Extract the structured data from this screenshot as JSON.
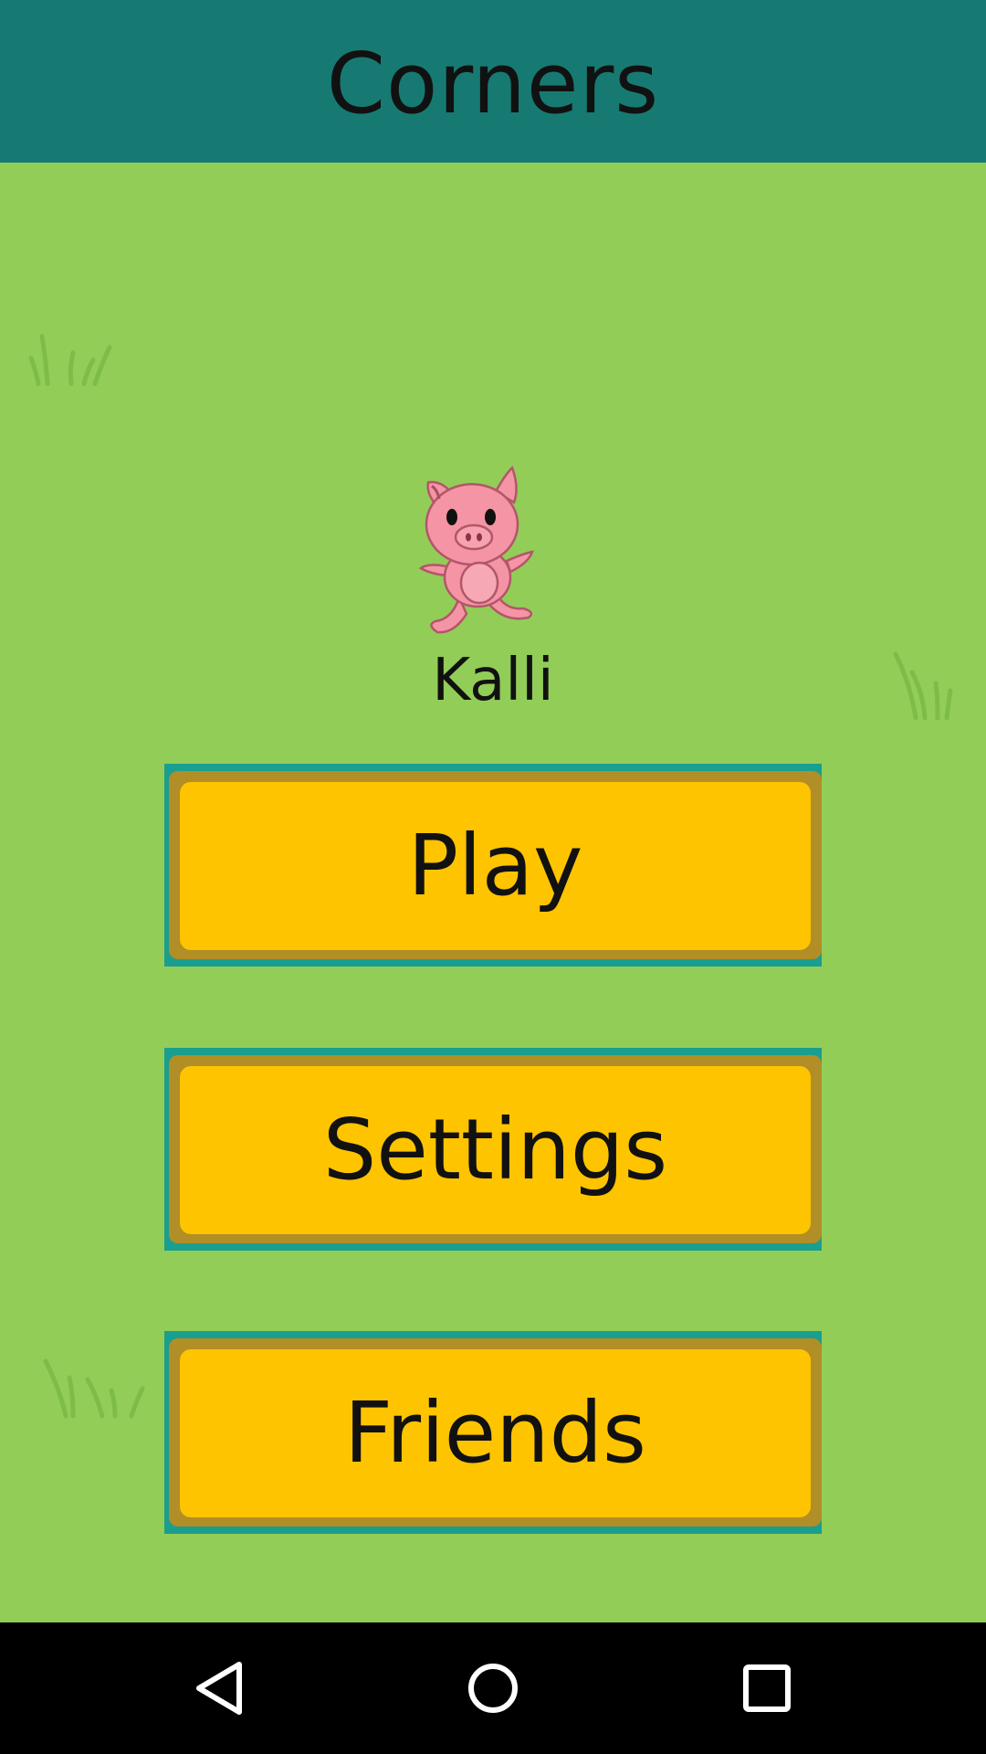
{
  "app_bar": {
    "title": "Corners",
    "background": "#167a72"
  },
  "scene": {
    "background": "#92cd58",
    "decorations": [
      "grass-tuft-icon",
      "grass-tuft-icon",
      "grass-tuft-icon"
    ],
    "character_icon": "pig-icon"
  },
  "player": {
    "name": "Kalli"
  },
  "menu": {
    "play_label": "Play",
    "settings_label": "Settings",
    "friends_label": "Friends",
    "button_color": "#ffc400",
    "button_border_color": "#b18e26"
  },
  "nav_bar": {
    "back_icon": "back-triangle-icon",
    "home_icon": "home-circle-icon",
    "recents_icon": "recents-square-icon"
  }
}
